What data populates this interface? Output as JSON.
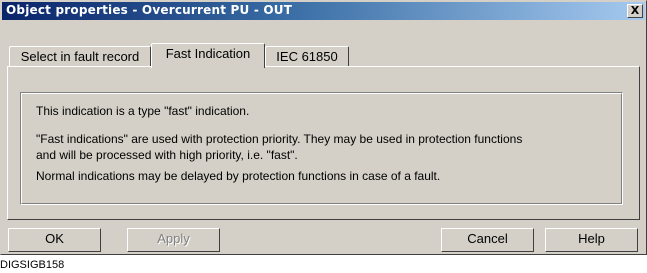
{
  "window": {
    "title": "Object properties - Overcurrent PU - OUT",
    "close_label": "X"
  },
  "tabs": [
    {
      "label": "Select in fault record",
      "active": false
    },
    {
      "label": "Fast Indication",
      "active": true
    },
    {
      "label": "IEC 61850",
      "active": false
    }
  ],
  "content": {
    "line1": "This indication is a type \"fast\" indication.",
    "line2": "\"Fast indications\" are used with protection priority.  They may be used in protection functions",
    "line3": "and will be processed with high priority, i.e. \"fast\".",
    "line4": "Normal indications may be delayed by protection functions in case of a fault."
  },
  "buttons": {
    "ok": "OK",
    "apply": "Apply",
    "cancel": "Cancel",
    "help": "Help"
  },
  "caption": "DIGSIGB158"
}
